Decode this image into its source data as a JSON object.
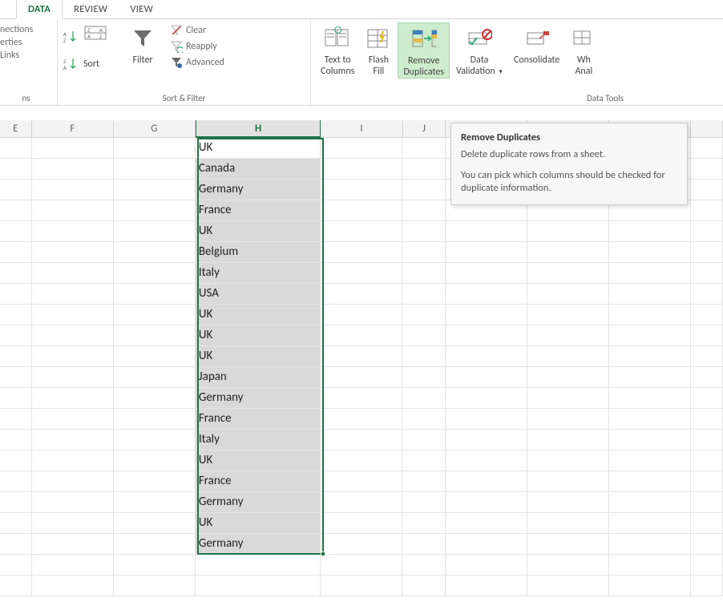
{
  "tabs": {
    "data": "DATA",
    "review": "REVIEW",
    "view": "VIEW"
  },
  "connections": {
    "nections": "nections",
    "erties": "erties",
    "links": "Links",
    "ns": "ns"
  },
  "sortfilter": {
    "sort": "Sort",
    "filter": "Filter",
    "clear": "Clear",
    "reapply": "Reapply",
    "advanced": "Advanced",
    "group": "Sort & Filter"
  },
  "datatools": {
    "texttocolumns1": "Text to",
    "texttocolumns2": "Columns",
    "flashfill1": "Flash",
    "flashfill2": "Fill",
    "removedup1": "Remove",
    "removedup2": "Duplicates",
    "datavalidation1": "Data",
    "datavalidation2": "Validation",
    "consolidate": "Consolidate",
    "whatif1": "Wh",
    "whatif2": "Anal",
    "group": "Data Tools"
  },
  "columns": {
    "E": "E",
    "F": "F",
    "G": "G",
    "H": "H",
    "I": "I",
    "J": "J"
  },
  "data_h": [
    "UK",
    "Canada",
    "Germany",
    "France",
    "UK",
    "Belgium",
    "Italy",
    "USA",
    "UK",
    "UK",
    "UK",
    "Japan",
    "Germany",
    "France",
    "Italy",
    "UK",
    "France",
    "Germany",
    "UK",
    "Germany"
  ],
  "tooltip": {
    "title": "Remove Duplicates",
    "p1": "Delete duplicate rows from a sheet.",
    "p2": "You can pick which columns should be checked for duplicate information."
  }
}
